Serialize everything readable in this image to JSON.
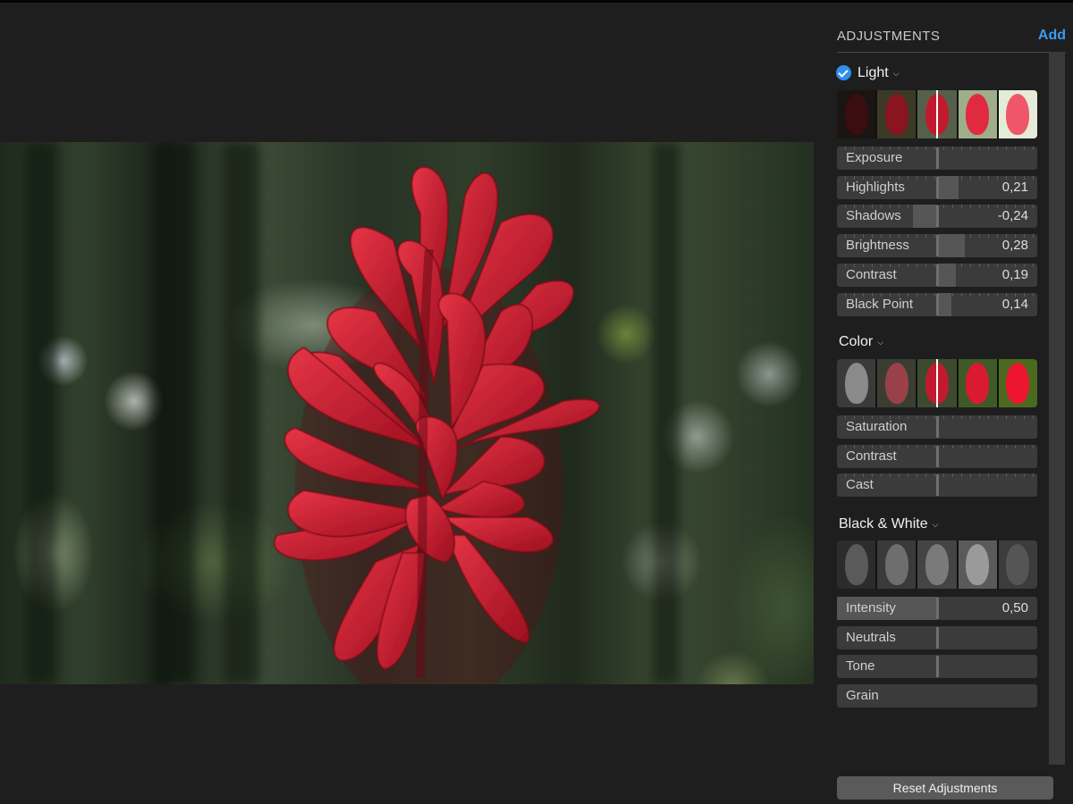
{
  "panel": {
    "title": "ADJUSTMENTS",
    "add_label": "Add",
    "reset_label": "Reset Adjustments"
  },
  "sections": {
    "light": {
      "title": "Light",
      "enabled": true,
      "sliders": [
        {
          "label": "Exposure",
          "value": "",
          "amount": 0
        },
        {
          "label": "Highlights",
          "value": "0,21",
          "amount": 0.21
        },
        {
          "label": "Shadows",
          "value": "-0,24",
          "amount": -0.24
        },
        {
          "label": "Brightness",
          "value": "0,28",
          "amount": 0.28
        },
        {
          "label": "Contrast",
          "value": "0,19",
          "amount": 0.19
        },
        {
          "label": "Black Point",
          "value": "0,14",
          "amount": 0.14
        }
      ]
    },
    "color": {
      "title": "Color",
      "sliders": [
        {
          "label": "Saturation",
          "value": "",
          "amount": 0
        },
        {
          "label": "Contrast",
          "value": "",
          "amount": 0
        },
        {
          "label": "Cast",
          "value": "",
          "amount": 0
        }
      ]
    },
    "bw": {
      "title": "Black & White",
      "sliders": [
        {
          "label": "Intensity",
          "value": "0,50",
          "amount": 0.5
        },
        {
          "label": "Neutrals",
          "value": "",
          "amount": 0
        },
        {
          "label": "Tone",
          "value": "",
          "amount": 0
        },
        {
          "label": "Grain",
          "value": "",
          "amount": null
        }
      ]
    }
  },
  "colors": {
    "accent": "#3d9bf2",
    "check": "#2f8ff0",
    "flower": "#c8192c"
  }
}
